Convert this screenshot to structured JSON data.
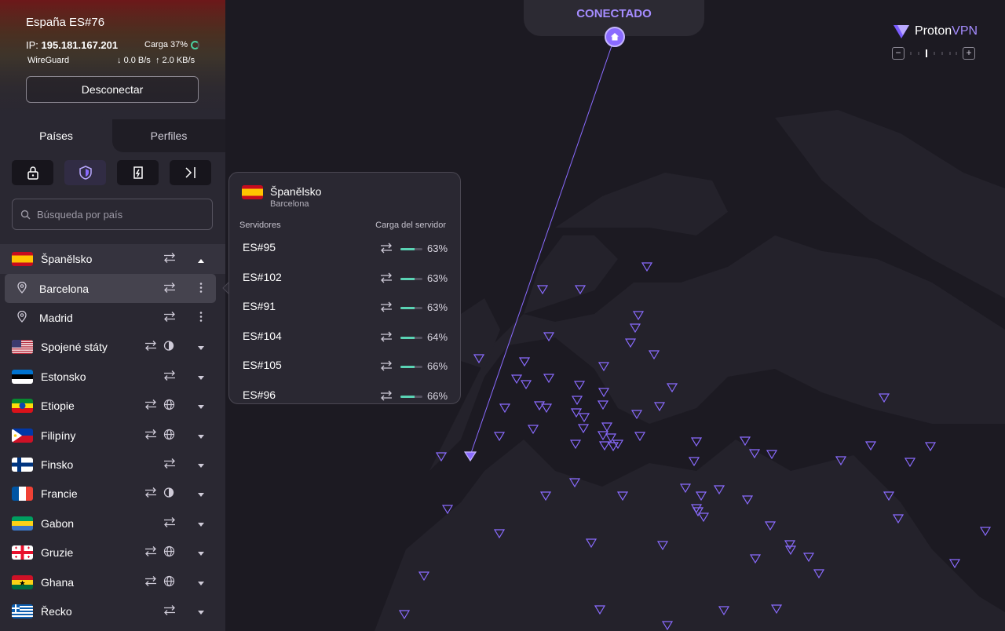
{
  "connection": {
    "server": "España ES#76",
    "ip_label": "IP:",
    "ip": "195.181.167.201",
    "load": "Carga 37%",
    "protocol": "WireGuard",
    "down": "0.0 B/s",
    "up": "2.0 KB/s",
    "disconnect_label": "Desconectar"
  },
  "tabs": {
    "countries": "Países",
    "profiles": "Perfiles"
  },
  "search": {
    "placeholder": "Búsqueda por país"
  },
  "countries": [
    {
      "name": "Španělsko",
      "flag": "es",
      "icons": [
        "p2p"
      ],
      "expanded": true,
      "cities": [
        {
          "name": "Barcelona",
          "highlighted": true
        },
        {
          "name": "Madrid",
          "highlighted": false
        }
      ]
    },
    {
      "name": "Spojené státy",
      "flag": "us",
      "icons": [
        "p2p",
        "tor"
      ]
    },
    {
      "name": "Estonsko",
      "flag": "ee",
      "icons": [
        "p2p"
      ]
    },
    {
      "name": "Etiopie",
      "flag": "et",
      "icons": [
        "p2p",
        "globe"
      ]
    },
    {
      "name": "Filipíny",
      "flag": "ph",
      "icons": [
        "p2p",
        "globe"
      ]
    },
    {
      "name": "Finsko",
      "flag": "fi",
      "icons": [
        "p2p"
      ]
    },
    {
      "name": "Francie",
      "flag": "fr",
      "icons": [
        "p2p",
        "tor"
      ]
    },
    {
      "name": "Gabon",
      "flag": "ga",
      "icons": [
        "p2p"
      ]
    },
    {
      "name": "Gruzie",
      "flag": "ge",
      "icons": [
        "p2p",
        "globe"
      ]
    },
    {
      "name": "Ghana",
      "flag": "gh",
      "icons": [
        "p2p",
        "globe"
      ]
    },
    {
      "name": "Řecko",
      "flag": "gr",
      "icons": [
        "p2p"
      ]
    }
  ],
  "map": {
    "status": "CONECTADO",
    "brand_a": "Proton",
    "brand_b": "VPN",
    "accent": "#8a6bff"
  },
  "popup": {
    "country": "Španělsko",
    "city": "Barcelona",
    "col_servers": "Servidores",
    "col_load": "Carga del servidor",
    "servers": [
      {
        "name": "ES#95",
        "load": "63%",
        "load_value": 63
      },
      {
        "name": "ES#102",
        "load": "63%",
        "load_value": 63
      },
      {
        "name": "ES#91",
        "load": "63%",
        "load_value": 63
      },
      {
        "name": "ES#104",
        "load": "64%",
        "load_value": 64
      },
      {
        "name": "ES#105",
        "load": "66%",
        "load_value": 66
      },
      {
        "name": "ES#96",
        "load": "66%",
        "load_value": 66
      }
    ]
  }
}
